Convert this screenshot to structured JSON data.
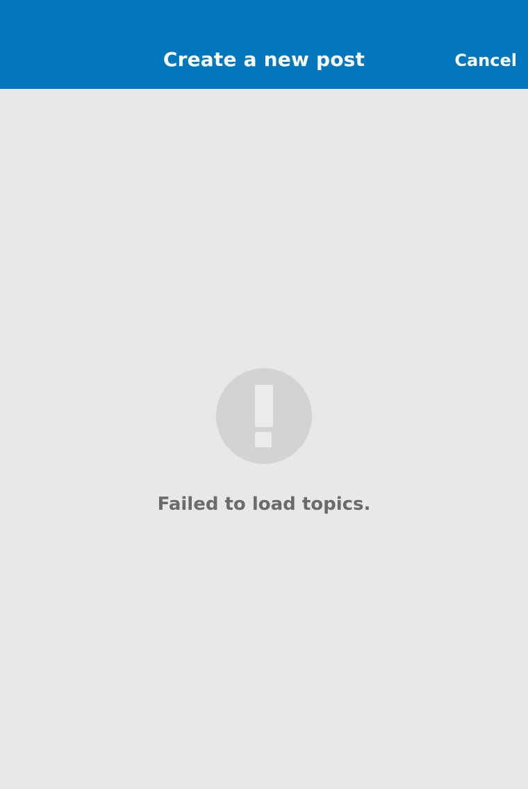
{
  "header": {
    "title": "Create a new post",
    "cancel_label": "Cancel",
    "background_color": "#0077bb"
  },
  "error": {
    "icon": "exclamation-circle-icon",
    "message": "Failed to load topics.",
    "icon_color": "#d4d2d2"
  },
  "page": {
    "background_color": "#e8e8e8"
  }
}
